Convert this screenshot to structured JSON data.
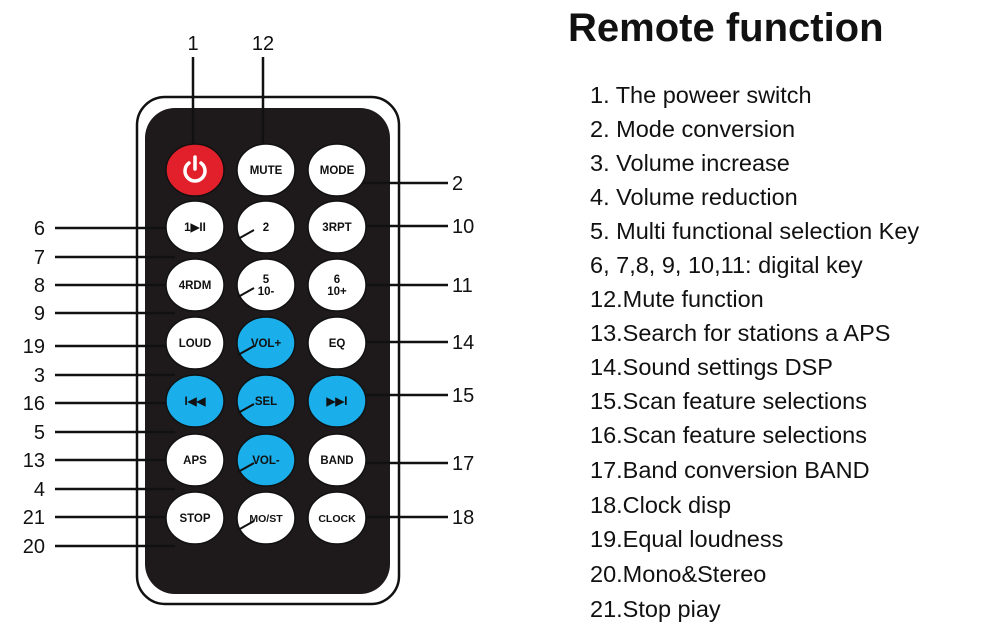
{
  "title": "Remote function",
  "colors": {
    "remote_body": "#1e1a1b",
    "power_button": "#e2202b",
    "blue_button": "#1aaeea",
    "white_button": "#ffffff",
    "line": "#111111"
  },
  "remote": {
    "buttons": [
      {
        "id": "power",
        "label": "",
        "icon": "power-icon",
        "color": "red",
        "row": 0,
        "col": 0
      },
      {
        "id": "mute",
        "label": "MUTE",
        "color": "white",
        "row": 0,
        "col": 1
      },
      {
        "id": "mode",
        "label": "MODE",
        "color": "white",
        "row": 0,
        "col": 2
      },
      {
        "id": "play-pause",
        "label": "1▶II",
        "color": "white",
        "row": 1,
        "col": 0
      },
      {
        "id": "two",
        "label": "2",
        "color": "white",
        "row": 1,
        "col": 1
      },
      {
        "id": "rpt",
        "label": "3RPT",
        "color": "white",
        "row": 1,
        "col": 2
      },
      {
        "id": "rdm",
        "label": "4RDM",
        "color": "white",
        "row": 2,
        "col": 0
      },
      {
        "id": "five",
        "label": "5\n10-",
        "color": "white",
        "row": 2,
        "col": 1
      },
      {
        "id": "six",
        "label": "6\n10+",
        "color": "white",
        "row": 2,
        "col": 2
      },
      {
        "id": "loud",
        "label": "LOUD",
        "color": "white",
        "row": 3,
        "col": 0
      },
      {
        "id": "vol-up",
        "label": "VOL+",
        "color": "blue",
        "row": 3,
        "col": 1
      },
      {
        "id": "eq",
        "label": "EQ",
        "color": "white",
        "row": 3,
        "col": 2
      },
      {
        "id": "prev",
        "label": "I◀◀",
        "icon": "previous-track-icon",
        "color": "blue",
        "row": 4,
        "col": 0
      },
      {
        "id": "sel",
        "label": "SEL",
        "color": "blue",
        "row": 4,
        "col": 1
      },
      {
        "id": "next",
        "label": "▶▶I",
        "icon": "next-track-icon",
        "color": "blue",
        "row": 4,
        "col": 2
      },
      {
        "id": "aps",
        "label": "APS",
        "color": "white",
        "row": 5,
        "col": 0
      },
      {
        "id": "vol-down",
        "label": "VOL-",
        "color": "blue",
        "row": 5,
        "col": 1
      },
      {
        "id": "band",
        "label": "BAND",
        "color": "white",
        "row": 5,
        "col": 2
      },
      {
        "id": "stop",
        "label": "STOP",
        "color": "white",
        "row": 6,
        "col": 0
      },
      {
        "id": "mo-st",
        "label": "MO/ST",
        "color": "white",
        "row": 6,
        "col": 1
      },
      {
        "id": "clock",
        "label": "CLOCK",
        "color": "white",
        "row": 6,
        "col": 2
      }
    ]
  },
  "callouts": {
    "top": [
      "1",
      "12"
    ],
    "left": [
      "6",
      "7",
      "8",
      "9",
      "19",
      "3",
      "16",
      "5",
      "13",
      "4",
      "21",
      "20"
    ],
    "right": [
      "2",
      "10",
      "11",
      "14",
      "15",
      "17",
      "18"
    ]
  },
  "functions": [
    "1. The poweer switch",
    "2. Mode conversion",
    "3. Volume increase",
    "4. Volume reduction",
    "5. Multi functional selection Key",
    "6, 7,8, 9, 10,11: digital key",
    "12.Mute function",
    "13.Search for stations a APS",
    "14.Sound settings DSP",
    "15.Scan feature selections",
    "16.Scan feature selections",
    "17.Band conversion BAND",
    "18.Clock disp",
    "19.Equal loudness",
    "20.Mono&Stereo",
    "21.Stop piay"
  ]
}
